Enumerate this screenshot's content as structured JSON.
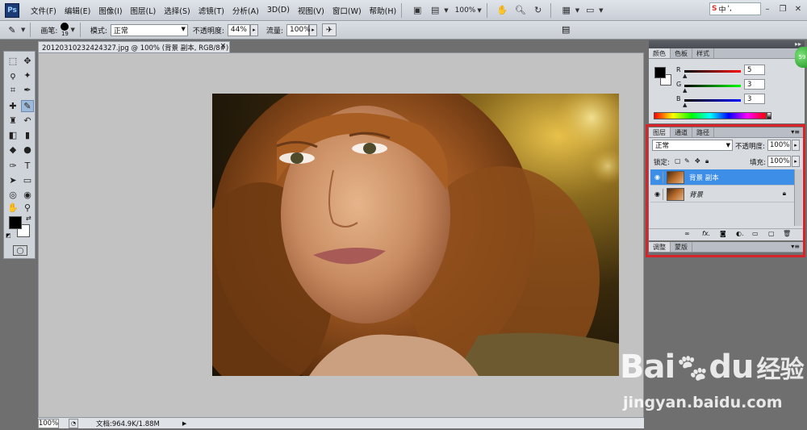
{
  "app": {
    "logo": "Ps"
  },
  "menu": {
    "items": [
      "文件(F)",
      "编辑(E)",
      "图像(I)",
      "图层(L)",
      "选择(S)",
      "滤镜(T)",
      "分析(A)",
      "3D(D)",
      "视图(V)",
      "窗口(W)",
      "帮助(H)"
    ],
    "zoom": "100%"
  },
  "ime": {
    "label": "中",
    "punct": "',"
  },
  "options": {
    "brush_label": "画笔:",
    "brush_size": "19",
    "mode_label": "模式:",
    "mode_value": "正常",
    "opacity_label": "不透明度:",
    "opacity_value": "44%",
    "flow_label": "流量:",
    "flow_value": "100%"
  },
  "document": {
    "tab_title": "20120310232424327.jpg @ 100% (背景 副本, RGB/8#) *",
    "close": "×"
  },
  "status": {
    "zoom": "100%",
    "doc_info": "文档:964.9K/1.88M"
  },
  "color_panel": {
    "tabs": [
      "颜色",
      "色板",
      "样式"
    ],
    "r_label": "R",
    "r_value": "5",
    "g_label": "G",
    "g_value": "3",
    "b_label": "B",
    "b_value": "3"
  },
  "layers_panel": {
    "tabs": [
      "图层",
      "通道",
      "路径"
    ],
    "blend_mode": "正常",
    "opacity_label": "不透明度:",
    "opacity_value": "100%",
    "lock_label": "锁定:",
    "fill_label": "填充:",
    "fill_value": "100%",
    "layers": [
      {
        "name": "背景 副本",
        "selected": true
      },
      {
        "name": "背景",
        "selected": false,
        "locked": true
      }
    ],
    "footer_icons": [
      "link-icon",
      "fx-icon",
      "mask-icon",
      "adjustment-icon",
      "group-icon",
      "new-layer-icon",
      "trash-icon"
    ]
  },
  "adjust_panel": {
    "tabs": [
      "调整",
      "蒙版"
    ]
  },
  "watermark": {
    "brand": "Bai",
    "brand2": "du",
    "brand_cn": "经验",
    "url": "jingyan.baidu.com"
  },
  "accent_colors": {
    "selection": "#3d8ee6",
    "highlight_box": "#d8232a"
  }
}
